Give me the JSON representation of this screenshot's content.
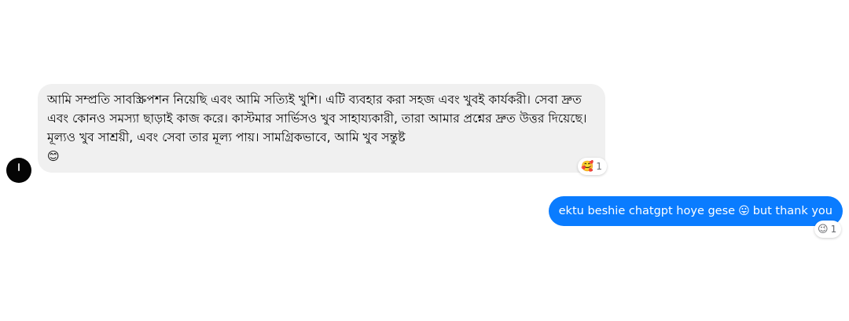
{
  "messages": [
    {
      "direction": "incoming",
      "text": "আমি সম্প্রতি সাবস্ক্রিপশন নিয়েছি এবং আমি সত্যিই খুশি। এটি ব্যবহার করা সহজ এবং খুবই কার্যকরী। সেবা দ্রুত এবং কোনও সমস্যা ছাড়াই কাজ করে। কাস্টমার সার্ভিসও খুব সাহায্যকারী, তারা আমার প্রশ্নের দ্রুত উত্তর দিয়েছে। মূল্যও খুব সাশ্রয়ী, এবং সেবা তার মূল্য পায়। সামগ্রিকভাবে, আমি খুব সন্তুষ্ট",
      "trailing_emoji": "😊",
      "reaction": {
        "emoji": "🥰",
        "count": "1",
        "icon": "smiling-face-with-hearts-icon"
      }
    },
    {
      "direction": "outgoing",
      "text_before": "ektu beshie chatgpt hoye gese",
      "inline_emoji": "😛",
      "text_after": "but thank you",
      "reaction": {
        "emoji": "😉",
        "count": "1",
        "icon": "winking-face-icon"
      }
    }
  ],
  "colors": {
    "incoming_bubble": "#f0f0f0",
    "outgoing_bubble": "#0a7cff",
    "avatar": "#050505"
  }
}
